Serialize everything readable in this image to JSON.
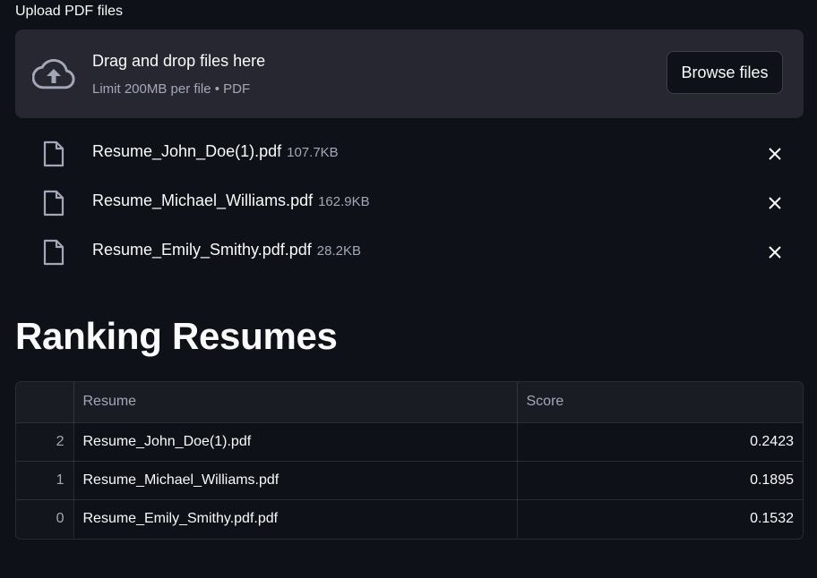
{
  "uploader": {
    "label": "Upload PDF files",
    "drop_title": "Drag and drop files here",
    "drop_subtitle": "Limit 200MB per file • PDF",
    "browse_label": "Browse files",
    "upload_icon": "cloud-upload-icon"
  },
  "files": [
    {
      "name": "Resume_John_Doe(1).pdf",
      "size": "107.7KB",
      "icon": "file-icon",
      "remove_icon": "close-icon"
    },
    {
      "name": "Resume_Michael_Williams.pdf",
      "size": "162.9KB",
      "icon": "file-icon",
      "remove_icon": "close-icon"
    },
    {
      "name": "Resume_Emily_Smithy.pdf.pdf",
      "size": "28.2KB",
      "icon": "file-icon",
      "remove_icon": "close-icon"
    }
  ],
  "ranking": {
    "title": "Ranking Resumes",
    "columns": [
      "",
      "Resume",
      "Score"
    ],
    "rows": [
      {
        "index": "2",
        "resume": "Resume_John_Doe(1).pdf",
        "score": "0.2423"
      },
      {
        "index": "1",
        "resume": "Resume_Michael_Williams.pdf",
        "score": "0.1895"
      },
      {
        "index": "0",
        "resume": "Resume_Emily_Smithy.pdf.pdf",
        "score": "0.1532"
      }
    ]
  },
  "colors": {
    "background": "#0e1117",
    "dropzone": "#262730",
    "muted_text": "#a3a8b8",
    "text": "#fafafa"
  }
}
